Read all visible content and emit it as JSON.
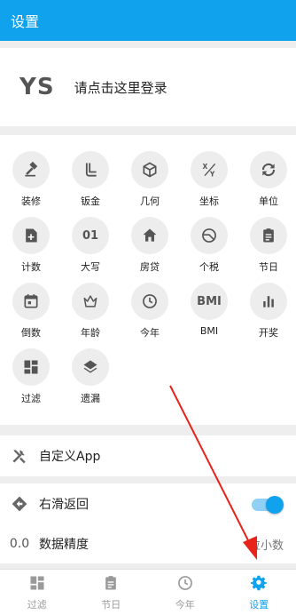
{
  "appbar": {
    "title": "设置"
  },
  "login": {
    "logo": "YS",
    "prompt": "请点击这里登录"
  },
  "tools": [
    {
      "label": "装修",
      "icon": "hammer-icon"
    },
    {
      "label": "钣金",
      "icon": "pipe-icon"
    },
    {
      "label": "几何",
      "icon": "cube-icon"
    },
    {
      "label": "坐标",
      "icon": "xy-icon"
    },
    {
      "label": "单位",
      "icon": "swap-icon"
    },
    {
      "label": "计数",
      "icon": "plus-box-icon"
    },
    {
      "label": "大写",
      "icon": "digit-icon",
      "glyph": "01"
    },
    {
      "label": "房贷",
      "icon": "home-icon"
    },
    {
      "label": "个税",
      "icon": "pie-icon"
    },
    {
      "label": "节日",
      "icon": "clipboard-icon"
    },
    {
      "label": "倒数",
      "icon": "calendar-icon"
    },
    {
      "label": "年龄",
      "icon": "crown-icon"
    },
    {
      "label": "今年",
      "icon": "clock-icon"
    },
    {
      "label": "BMI",
      "icon": "bmi-icon",
      "glyph": "BMI"
    },
    {
      "label": "开奖",
      "icon": "bar-chart-icon"
    },
    {
      "label": "过滤",
      "icon": "dashboard-icon"
    },
    {
      "label": "遗漏",
      "icon": "layers-icon"
    }
  ],
  "settings": {
    "custom_app": "自定义App",
    "swipe_back": "右滑返回",
    "swipe_back_enabled": true,
    "precision_icon_text": "0.0",
    "precision_label": "数据精度",
    "precision_value": "位小数"
  },
  "tabs": [
    {
      "label": "过滤",
      "icon": "dashboard-icon",
      "active": false
    },
    {
      "label": "节日",
      "icon": "clipboard-icon",
      "active": false
    },
    {
      "label": "今年",
      "icon": "clock-icon",
      "active": false
    },
    {
      "label": "设置",
      "icon": "gear-icon",
      "active": true
    }
  ],
  "colors": {
    "primary": "#11a2ee",
    "arrow": "#e8231a"
  }
}
